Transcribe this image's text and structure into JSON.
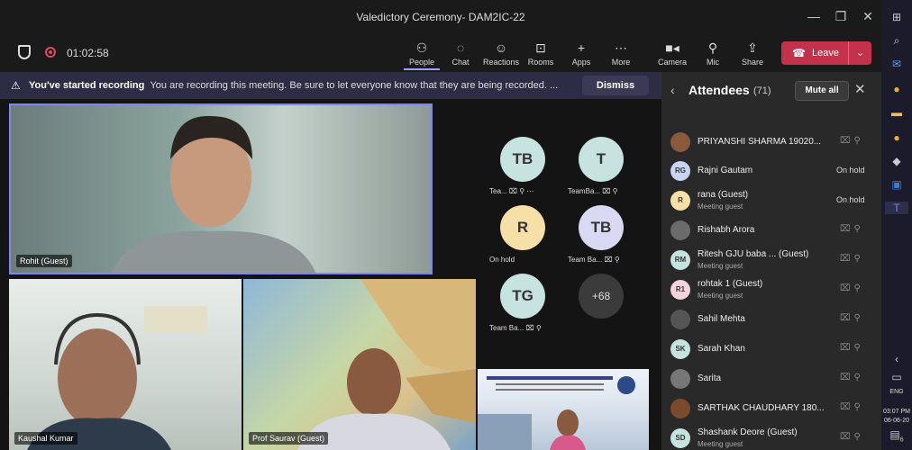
{
  "window": {
    "title": "Valedictory Ceremony- DAM2IC-22",
    "min": "—",
    "max": "❐",
    "close": "✕"
  },
  "meeting": {
    "timer": "01:02:58"
  },
  "toolbar": {
    "people": "People",
    "chat": "Chat",
    "reactions": "Reactions",
    "rooms": "Rooms",
    "apps": "Apps",
    "more": "More",
    "camera": "Camera",
    "mic": "Mic",
    "share": "Share",
    "leave": "Leave"
  },
  "banner": {
    "warning_icon": "⚠",
    "title": "You've started recording",
    "text": "You are recording this meeting. Be sure to let everyone know that they are being recorded. ...",
    "dismiss": "Dismiss"
  },
  "tiles": {
    "rohit": "Rohit (Guest)",
    "kaushal": "Kaushal Kumar",
    "saurav": "Prof Saurav (Guest)"
  },
  "avatars": [
    {
      "initials": "TB",
      "label": "Tea... ⌧ ⚲ ⋯",
      "color": "#c7e3e0"
    },
    {
      "initials": "T",
      "label": "TeamBa... ⌧ ⚲",
      "color": "#c7e3e0"
    },
    {
      "initials": "R",
      "label": "On hold",
      "color": "#f6e0a8"
    },
    {
      "initials": "TB",
      "label": "Team Ba... ⌧ ⚲",
      "color": "#d9d9f3"
    },
    {
      "initials": "TG",
      "label": "Team Ba... ⌧ ⚲",
      "color": "#c7e3e0"
    },
    {
      "initials": "+68",
      "label": "",
      "color": "#3b3b3b"
    }
  ],
  "panel": {
    "title": "Attendees",
    "count": "(71)",
    "mute_all": "Mute all",
    "back": "‹",
    "close": "✕"
  },
  "attendees": [
    {
      "initials": "",
      "name": "PRIYANSHI SHARMA 19020...",
      "sub": "",
      "status": "",
      "color": "#8a5a3c",
      "photo": true
    },
    {
      "initials": "RG",
      "name": "Rajni Gautam",
      "sub": "",
      "status": "On hold",
      "color": "#c9d4f0"
    },
    {
      "initials": "R",
      "name": "rana (Guest)",
      "sub": "Meeting guest",
      "status": "On hold",
      "color": "#f6e0a8"
    },
    {
      "initials": "",
      "name": "Rishabh Arora",
      "sub": "",
      "status": "",
      "color": "#6b6b6b",
      "photo": true
    },
    {
      "initials": "RM",
      "name": "Ritesh GJU baba ... (Guest)",
      "sub": "Meeting guest",
      "status": "",
      "color": "#c7e3e0"
    },
    {
      "initials": "R1",
      "name": "rohtak 1 (Guest)",
      "sub": "Meeting guest",
      "status": "",
      "color": "#f4d4dc"
    },
    {
      "initials": "",
      "name": "Sahil Mehta",
      "sub": "",
      "status": "",
      "color": "#555",
      "photo": true
    },
    {
      "initials": "SK",
      "name": "Sarah Khan",
      "sub": "",
      "status": "",
      "color": "#c7e3e0"
    },
    {
      "initials": "",
      "name": "Sarita",
      "sub": "",
      "status": "",
      "color": "#777",
      "photo": true
    },
    {
      "initials": "",
      "name": "SARTHAK CHAUDHARY 180...",
      "sub": "",
      "status": "",
      "color": "#7a4a2a",
      "photo": true
    },
    {
      "initials": "SD",
      "name": "Shashank Deore (Guest)",
      "sub": "Meeting guest",
      "status": "",
      "color": "#c7e3e0"
    }
  ],
  "taskbar": {
    "lang": "ENG",
    "time": "03:07 PM",
    "date": "06-06-20",
    "notif": "6"
  }
}
